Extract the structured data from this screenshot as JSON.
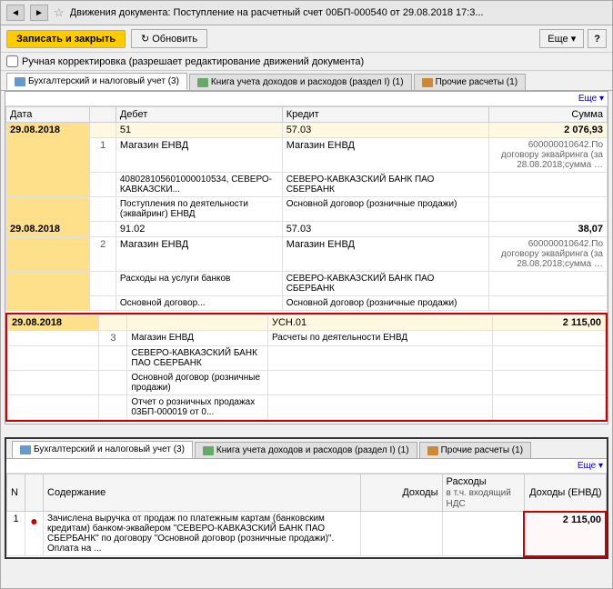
{
  "window": {
    "title": "Движения документа: Поступление на расчетный счет 00БП-000540 от 29.08.2018 17:3...",
    "nav_back": "◄",
    "nav_forward": "►",
    "star": "☆"
  },
  "toolbar": {
    "save_label": "Записать и закрыть",
    "refresh_label": "Обновить",
    "more_label": "Еще ▾",
    "help_label": "?"
  },
  "checkbox": {
    "label": "Ручная корректировка (разрешает редактирование движений документа)"
  },
  "tabs_top": {
    "items": [
      {
        "label": "Бухгалтерский и налоговый учет (3)",
        "icon": "blue",
        "active": true
      },
      {
        "label": "Книга учета доходов и расходов (раздел I) (1)",
        "icon": "green",
        "active": false
      },
      {
        "label": "Прочие расчеты (1)",
        "icon": "orange",
        "active": false
      }
    ]
  },
  "table_top": {
    "more_label": "Еще ▾",
    "headers": [
      "Дата",
      "",
      "Дебет",
      "Кредит",
      "Сумма"
    ],
    "rows": [
      {
        "date": "29.08.2018",
        "num": "",
        "debet": "51",
        "kredit": "57.03",
        "summa": "2 076,93",
        "type": "main",
        "highlighted": true
      },
      {
        "date": "",
        "num": "1",
        "debet": "Магазин ЕНВД",
        "kredit": "Магазин ЕНВД",
        "summa": "600000010642.По договору эквайринга (за 28.08.2018;сумма …",
        "type": "sub"
      },
      {
        "date": "",
        "num": "",
        "debet": "408028105601000010534, СЕВЕРО-КАВКАЗСКИ...",
        "kredit": "СЕВЕРО-КАВКАЗСКИЙ БАНК ПАО СБЕРБАНК",
        "summa": "",
        "type": "sub"
      },
      {
        "date": "",
        "num": "",
        "debet": "Поступления по деятельности (эквайринг) ЕНВД",
        "kredit": "Основной договор (розничные продажи)",
        "summa": "",
        "type": "sub"
      },
      {
        "date": "29.08.2018",
        "num": "",
        "debet": "91.02",
        "kredit": "57.03",
        "summa": "38,07",
        "type": "main"
      },
      {
        "date": "",
        "num": "2",
        "debet": "Магазин ЕНВД",
        "kredit": "Магазин ЕНВД",
        "summa": "600000010642.По договору эквайринга (за 28.08.2018;сумма …",
        "type": "sub"
      },
      {
        "date": "",
        "num": "",
        "debet": "Расходы на услуги банков",
        "kredit": "СЕВЕРО-КАВКАЗСКИЙ БАНК ПАО СБЕРБАНК",
        "summa": "",
        "type": "sub"
      },
      {
        "date": "",
        "num": "",
        "debet": "Основной договор...",
        "kredit": "Основной договор (розничные продажи)",
        "summa": "",
        "type": "sub"
      }
    ],
    "selected_rows": [
      {
        "date": "29.08.2018",
        "num": "",
        "debet": "",
        "kredit": "УСН.01",
        "summa": "2 115,00",
        "type": "main"
      },
      {
        "date": "",
        "num": "3",
        "debet": "Магазин ЕНВД",
        "kredit": "Расчеты по деятельности ЕНВД",
        "summa": "",
        "type": "sub"
      },
      {
        "date": "",
        "num": "",
        "debet": "СЕВЕРО-КАВКАЗСКИЙ БАНК ПАО СБЕРБАНК",
        "kredit": "",
        "summa": "",
        "type": "sub"
      },
      {
        "date": "",
        "num": "",
        "debet": "Основной договор (розничные продажи)",
        "kredit": "",
        "summa": "",
        "type": "sub"
      },
      {
        "date": "",
        "num": "",
        "debet": "Отчет о розничных продажах 03БП-000019 от 0...",
        "kredit": "",
        "summa": "",
        "type": "sub"
      }
    ]
  },
  "tabs_bottom": {
    "items": [
      {
        "label": "Бухгалтерский и налоговый учет (3)",
        "icon": "blue",
        "active": true
      },
      {
        "label": "Книга учета доходов и расходов (раздел I) (1)",
        "icon": "green",
        "active": false
      },
      {
        "label": "Прочие расчеты (1)",
        "icon": "orange",
        "active": false
      }
    ]
  },
  "table_bottom": {
    "more_label": "Еще ▾",
    "headers": {
      "n": "N",
      "content": "Содержание",
      "income": "Доходы",
      "expense": "Расходы",
      "expense_sub": "в т.ч. входящий НДС",
      "income_envd": "Доходы (ЕНВД)"
    },
    "rows": [
      {
        "dot": "●",
        "num": "1",
        "content": "Зачислена выручка от продаж по платежным картам (банковским кредитам) банком-эквайером \"СЕВЕРО-КАВКАЗСКИЙ БАНК ПАО СБЕРБАНК\" по договору \"Основной договор (розничные продажи)\". Оплата на ...",
        "income": "",
        "expense": "",
        "income_envd": "2 115,00"
      }
    ]
  }
}
